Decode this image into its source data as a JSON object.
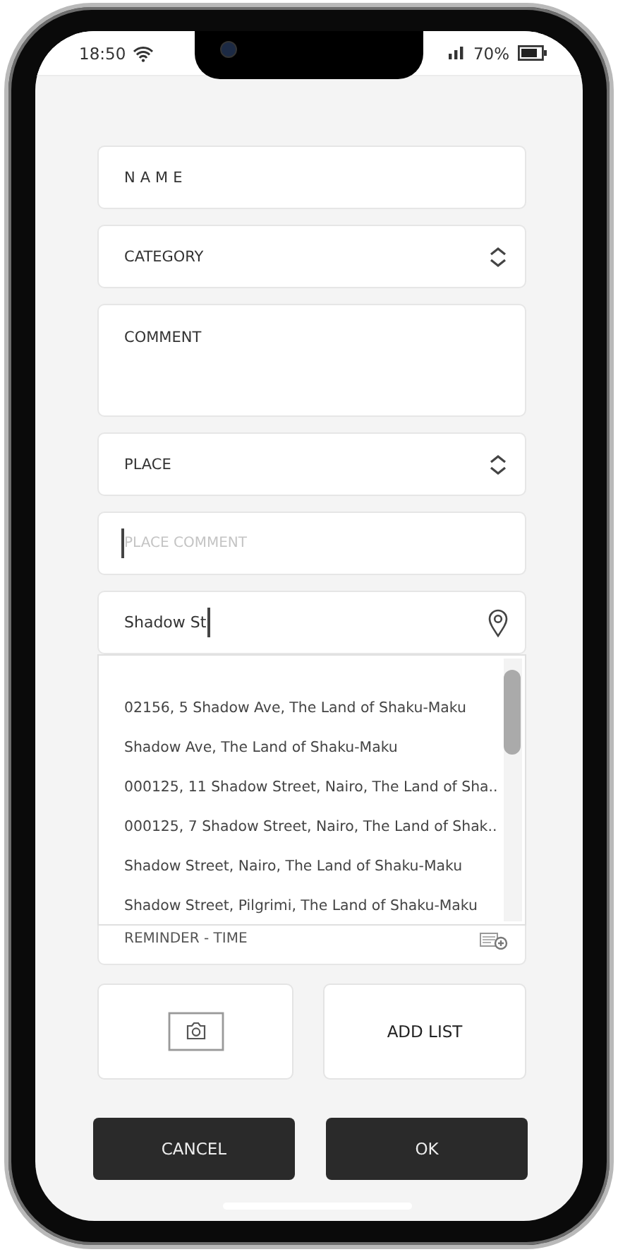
{
  "status_bar": {
    "time": "18:50",
    "battery": "70%"
  },
  "fields": [
    {
      "kind": "text",
      "label": "NAME"
    },
    {
      "kind": "select",
      "label": "CATEGORY"
    },
    {
      "kind": "area",
      "label": "COMMENT"
    },
    {
      "kind": "select",
      "label": "PLACE"
    },
    {
      "kind": "input",
      "placeholder": "PLACE COMMENT",
      "focused": true
    }
  ],
  "address": {
    "value": "Shadow St",
    "focused": true,
    "suggestions": [
      "02156, 5 Shadow Ave, The Land of Shaku-Maku",
      "Shadow Ave, The Land of Shaku-Maku",
      "000125, 11 Shadow Street, Nairo, The Land of Sha..",
      "000125, 7 Shadow Street, Nairo, The Land of Shak..",
      "Shadow Street, Nairo, The Land of Shaku-Maku",
      "Shadow Street, Pilgrimi, The Land of Shaku-Maku"
    ]
  },
  "reminder": {
    "label": "REMINDER - TIME"
  },
  "tiles": {
    "add_list": "ADD LIST"
  },
  "buttons": [
    "CANCEL",
    "OK"
  ]
}
